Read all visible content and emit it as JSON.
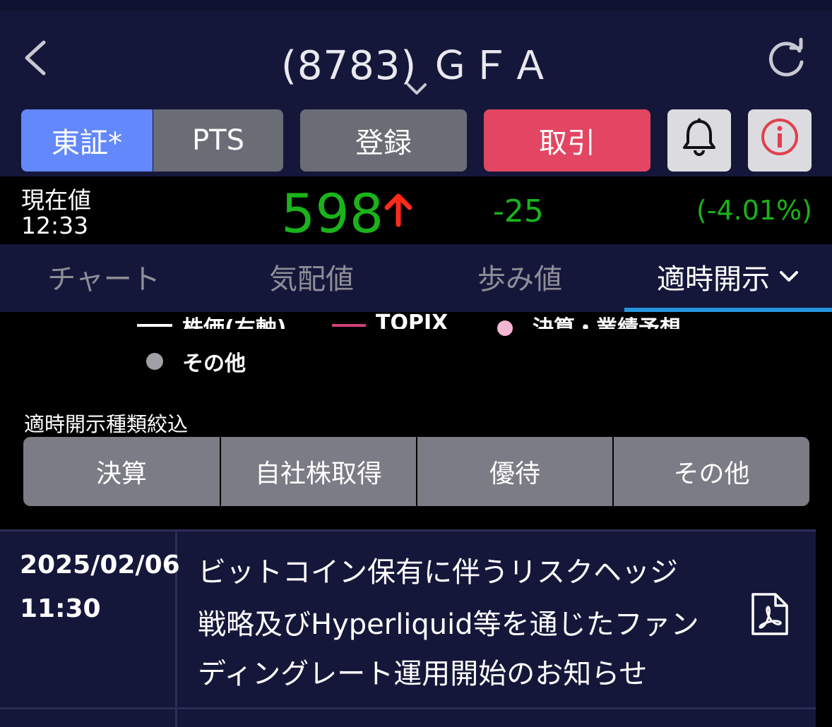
{
  "header": {
    "title": "(8783) ＧＦＡ",
    "back_icon": "chevron-left-icon",
    "refresh_icon": "refresh-icon",
    "title_dropdown_icon": "chevron-down-icon"
  },
  "buttons": {
    "market_segments": [
      {
        "label": "東証*",
        "selected": true
      },
      {
        "label": "PTS",
        "selected": false
      }
    ],
    "register_label": "登録",
    "trade_label": "取引",
    "bell_icon": "bell-icon",
    "info_icon": "info-icon"
  },
  "price": {
    "label": "現在値",
    "time": "12:33",
    "value": "598",
    "direction_icon": "arrow-up-icon",
    "change": "-25",
    "change_percent": "(-4.01%)"
  },
  "tabs": [
    {
      "label": "チャート",
      "active": false
    },
    {
      "label": "気配値",
      "active": false
    },
    {
      "label": "歩み値",
      "active": false
    },
    {
      "label": "適時開示",
      "active": true
    }
  ],
  "legend": {
    "stock": "株価(右軸)",
    "topix": "TOPIX",
    "earnings": "決算・業績予想",
    "other": "その他"
  },
  "filter": {
    "label": "適時開示種類絞込",
    "options": [
      "決算",
      "自社株取得",
      "優待",
      "その他"
    ]
  },
  "disclosures": [
    {
      "date": "2025/02/06",
      "time": "11:30",
      "title_lines": [
        "ビットコイン保有に伴うリスクヘッジ",
        "戦略及びHyperliquid等を通じたファン",
        "ディングレート運用開始のお知らせ"
      ],
      "doc_icon": "pdf-icon"
    }
  ],
  "colors": {
    "header_bg": "#15173a",
    "segment_selected": "#6288fb",
    "trade_button": "#e24662",
    "price_green": "#1ab31a",
    "tab_indicator": "#2496dc",
    "up_arrow": "#ff2a1a"
  }
}
